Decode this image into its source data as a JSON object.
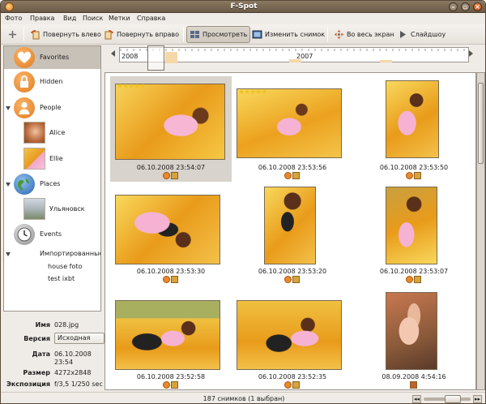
{
  "window": {
    "title": "F-Spot"
  },
  "menu": [
    "Фото",
    "Правка",
    "Вид",
    "Поиск",
    "Метки",
    "Справка"
  ],
  "toolbar": {
    "rotate_left": "Повернуть влево",
    "rotate_right": "Повернуть вправо",
    "view": "Просмотреть",
    "edit": "Изменить снимок",
    "fullscreen": "Во весь экран",
    "slideshow": "Слайдшоу"
  },
  "sidebar": {
    "favorites": "Favorites",
    "hidden": "Hidden",
    "people": "People",
    "alice": "Alice",
    "ellie": "Ellie",
    "places": "Places",
    "city": "Ульяновск",
    "events": "Events",
    "imported": "Импортированные",
    "imported_items": [
      "house foto",
      "test ixbt"
    ]
  },
  "info": {
    "name_label": "Имя",
    "name_value": "028.jpg",
    "version_label": "Версия",
    "version_value": "Исходная",
    "date_label": "Дата",
    "date_value_1": "06.10.2008",
    "date_value_2": "23:54",
    "size_label": "Размер",
    "size_value": "4272x2848",
    "exposure_label": "Экспозиция",
    "exposure_value": "f/3,5 1/250 sec"
  },
  "timeline": {
    "years": [
      "2008",
      "2007"
    ]
  },
  "photos": [
    {
      "date": "06.10.2008 23:54:07",
      "rating": 5,
      "selected": true
    },
    {
      "date": "06.10.2008 23:53:56",
      "rating": 5,
      "selected": false
    },
    {
      "date": "06.10.2008 23:53:50",
      "rating": 0,
      "selected": false
    },
    {
      "date": "06.10.2008 23:53:30",
      "rating": 0,
      "selected": false
    },
    {
      "date": "06.10.2008 23:53:20",
      "rating": 0,
      "selected": false
    },
    {
      "date": "06.10.2008 23:53:07",
      "rating": 0,
      "selected": false
    },
    {
      "date": "06.10.2008 23:52:58",
      "rating": 0,
      "selected": false
    },
    {
      "date": "06.10.2008 23:52:35",
      "rating": 0,
      "selected": false
    },
    {
      "date": "08.09.2008 4:54:16",
      "rating": 0,
      "selected": false
    }
  ],
  "status": {
    "text": "187 снимков (1 выбран)"
  },
  "colors": {
    "accent": "#e98a2a",
    "titlebar": "#7a6852",
    "selection": "#c7c1b8"
  }
}
